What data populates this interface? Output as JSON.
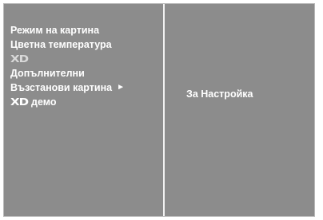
{
  "menu": {
    "items": [
      {
        "label": "Режим на картина"
      },
      {
        "label": "Цветна температура"
      },
      {
        "logo": "XD"
      },
      {
        "label": "Допълнителни"
      },
      {
        "label": "Възстанови картина",
        "arrow": "►"
      },
      {
        "logo": "XD",
        "suffix": "демо"
      }
    ]
  },
  "submenu": {
    "value": "За Настройка"
  },
  "colors": {
    "panel": "#8c8c8c",
    "text": "#ffffff",
    "divider": "#f2f2f2"
  }
}
